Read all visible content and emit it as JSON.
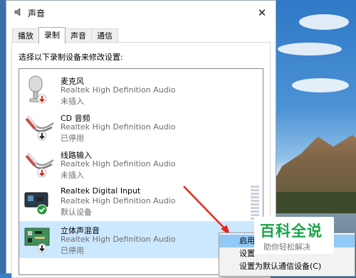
{
  "window": {
    "title": "声音",
    "close_glyph": "✕"
  },
  "tabs": [
    {
      "label": "播放",
      "active": false
    },
    {
      "label": "录制",
      "active": true
    },
    {
      "label": "声音",
      "active": false
    },
    {
      "label": "通信",
      "active": false
    }
  ],
  "instruction": "选择以下录制设备来修改设置:",
  "devices": [
    {
      "name": "麦克风",
      "driver": "Realtek High Definition Audio",
      "status": "未插入",
      "icon": "microphone-icon",
      "badge": "red-down-arrow"
    },
    {
      "name": "CD 音频",
      "driver": "Realtek High Definition Audio",
      "status": "已停用",
      "icon": "rca-cable-icon",
      "badge": "black-down-arrow"
    },
    {
      "name": "线路输入",
      "driver": "Realtek High Definition Audio",
      "status": "未插入",
      "icon": "rca-cable-icon",
      "badge": "red-down-arrow"
    },
    {
      "name": "Realtek Digital Input",
      "driver": "Realtek High Definition Audio",
      "status": "默认设备",
      "icon": "digital-input-icon",
      "badge": "green-check"
    },
    {
      "name": "立体声混音",
      "driver": "Realtek High Definition Audio",
      "status": "已停用",
      "icon": "circuit-board-icon",
      "badge": "black-down-arrow",
      "selected": true
    }
  ],
  "context_menu": {
    "items": [
      {
        "label": "启用",
        "highlighted": true
      },
      {
        "label": "设置"
      },
      {
        "label": "设置为默认通信设备(C)"
      }
    ]
  },
  "watermark": {
    "title": "百科全说",
    "subtitle": "助你轻松解决"
  },
  "colors": {
    "selection": "#cce8ff",
    "menu_highlight": "#91c9f7",
    "watermark_green": "#1aa34a",
    "arrow": "#e8261e"
  }
}
